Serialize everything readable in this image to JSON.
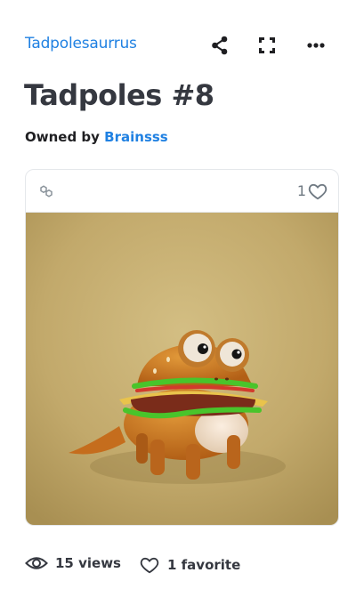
{
  "header": {
    "collection": "Tadpolesaurrus",
    "icons": [
      "share-icon",
      "fullscreen-icon",
      "more-icon"
    ]
  },
  "asset": {
    "title": "Tadpoles #8",
    "owned_by_label": "Owned by",
    "owner": "Brainsss"
  },
  "card": {
    "chain_icon": "polygon-chain-icon",
    "favorite_count": "1"
  },
  "stats": {
    "views": "15 views",
    "favorites": "1 favorite"
  },
  "colors": {
    "accent": "#2081e2",
    "text": "#353840",
    "muted": "#707a83",
    "art_background": "#c4ad70"
  }
}
